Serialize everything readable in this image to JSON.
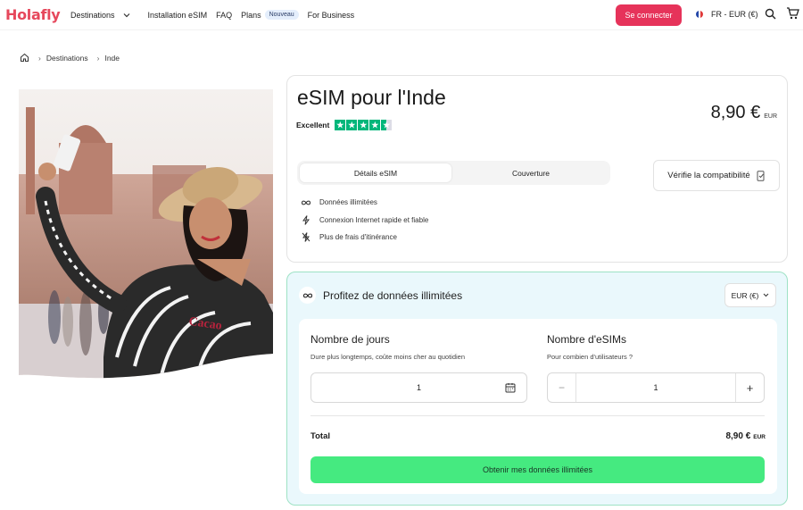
{
  "header": {
    "logo": "Holafly",
    "nav": {
      "destinations": "Destinations",
      "installation": "Installation eSIM",
      "faq": "FAQ",
      "plans": "Plans",
      "plans_badge": "Nouveau",
      "business": "For Business"
    },
    "login_button": "Se connecter",
    "language": "FR - EUR (€)",
    "accent_color": "#e6335a"
  },
  "breadcrumb": {
    "items": [
      "Destinations",
      "Inde"
    ]
  },
  "product": {
    "title": "eSIM pour l'Inde",
    "rating_label": "Excellent",
    "rating_stars": 4.5,
    "price": "8,90 €",
    "price_currency": "EUR",
    "tabs": [
      "Détails eSIM",
      "Couverture"
    ],
    "active_tab": 0,
    "compat_button": "Vérifie la compatibilité",
    "features": [
      {
        "icon": "infinity-icon",
        "text": "Données illimitées"
      },
      {
        "icon": "lightning-icon",
        "text": "Connexion Internet rapide et fiable"
      },
      {
        "icon": "no-roaming-icon",
        "text": "Plus de frais d'itinérance"
      }
    ]
  },
  "config": {
    "heading": "Profitez de données illimitées",
    "currency_select": "EUR (€)",
    "days": {
      "title": "Nombre de jours",
      "subtitle": "Dure plus longtemps, coûte moins cher au quotidien",
      "value": "1"
    },
    "sims": {
      "title": "Nombre d'eSIMs",
      "subtitle": "Pour combien d'utilisateurs ?",
      "value": "1",
      "minus": "−",
      "plus": "+"
    },
    "total_label": "Total",
    "total_value": "8,90 €",
    "total_currency": "EUR",
    "cta": "Obtenir mes données illimitées",
    "cta_color": "#45ea80"
  }
}
